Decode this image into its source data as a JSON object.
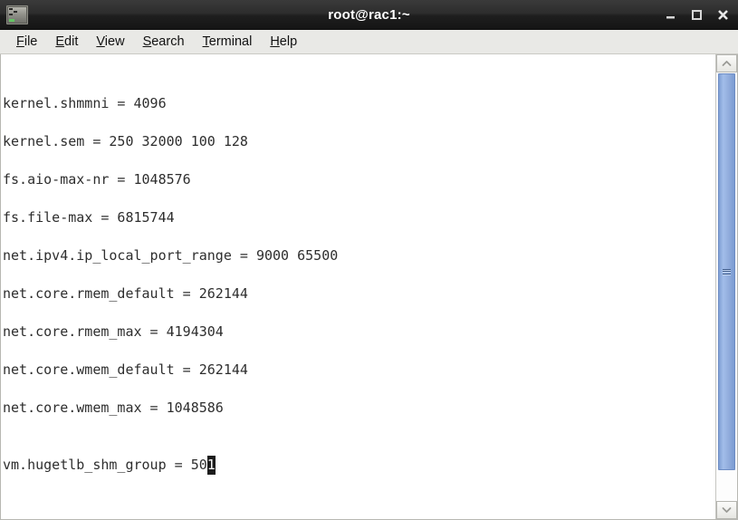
{
  "window": {
    "title": "root@rac1:~",
    "icon_name": "terminal-app-icon",
    "controls": {
      "minimize_label": "Minimize",
      "maximize_label": "Maximize",
      "close_label": "Close"
    }
  },
  "menubar": {
    "items": [
      {
        "label": "File",
        "mnemonic": "F",
        "rest": "ile"
      },
      {
        "label": "Edit",
        "mnemonic": "E",
        "rest": "dit"
      },
      {
        "label": "View",
        "mnemonic": "V",
        "rest": "iew"
      },
      {
        "label": "Search",
        "mnemonic": "S",
        "rest": "earch"
      },
      {
        "label": "Terminal",
        "mnemonic": "T",
        "rest": "erminal"
      },
      {
        "label": "Help",
        "mnemonic": "H",
        "rest": "elp"
      }
    ]
  },
  "terminal": {
    "background_color": "#ffffff",
    "text_color": "#2e2e2e",
    "lines": [
      "",
      "",
      "kernel.shmmni = 4096",
      "",
      "kernel.sem = 250 32000 100 128",
      "",
      "fs.aio-max-nr = 1048576",
      "",
      "fs.file-max = 6815744",
      "",
      "net.ipv4.ip_local_port_range = 9000 65500",
      "",
      "net.core.rmem_default = 262144",
      "",
      "net.core.rmem_max = 4194304",
      "",
      "net.core.wmem_default = 262144",
      "",
      "net.core.wmem_max = 1048586",
      "",
      ""
    ],
    "last_line": {
      "text": "vm.hugetlb_shm_group = 50",
      "cursor_char": "1"
    }
  },
  "scrollbar": {
    "up_arrow_name": "scroll-up-arrow",
    "down_arrow_name": "scroll-down-arrow",
    "thumb_color": "#92addd"
  }
}
